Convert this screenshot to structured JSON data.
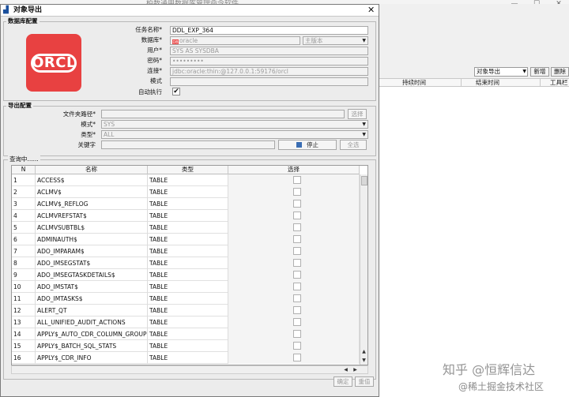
{
  "background": {
    "app_title": "柏数通用数据库管理命令软件",
    "toolbar": {
      "export_select": "对象导出",
      "new_button": "新增",
      "delete_button": "删除",
      "tools_button": "工具栏"
    },
    "columns": [
      "持续时间",
      "结束时间",
      "工具栏"
    ]
  },
  "dialog": {
    "title": "对象导出",
    "close": "✕",
    "db_config": {
      "group_label": "数据库配置",
      "logo_text": "ORCL",
      "task_name_label": "任务名称*",
      "task_name_value": "DDL_EXP_364",
      "database_label": "数据库*",
      "database_value": "oracle",
      "database_mode_value": "主版本",
      "user_label": "用户*",
      "user_value": "SYS AS SYSDBA",
      "password_label": "密码*",
      "password_value": "•••••••••",
      "connection_label": "连接*",
      "connection_value": "jdbc:oracle:thin:@127.0.0.1:59176/orcl",
      "schema_label": "模式",
      "schema_value": "",
      "auto_exec_label": "自动执行",
      "auto_exec_checked": "✔"
    },
    "export_config": {
      "group_label": "导出配置",
      "folder_label": "文件夹路径*",
      "folder_value": "",
      "browse_button": "选择",
      "schema_label": "模式*",
      "schema_value": "SYS",
      "type_label": "类型*",
      "type_value": "ALL",
      "keyword_label": "关键字",
      "keyword_value": "",
      "stop_button": "停止",
      "select_all_button": "全选"
    },
    "query": {
      "group_label": "查询中......",
      "columns": [
        "N",
        "名称",
        "类型",
        "选择"
      ],
      "rows": [
        {
          "n": "1",
          "name": "ACCESS$",
          "type": "TABLE"
        },
        {
          "n": "2",
          "name": "ACLMV$",
          "type": "TABLE"
        },
        {
          "n": "3",
          "name": "ACLMV$_REFLOG",
          "type": "TABLE"
        },
        {
          "n": "4",
          "name": "ACLMVREFSTAT$",
          "type": "TABLE"
        },
        {
          "n": "5",
          "name": "ACLMVSUBTBL$",
          "type": "TABLE"
        },
        {
          "n": "6",
          "name": "ADMINAUTH$",
          "type": "TABLE"
        },
        {
          "n": "7",
          "name": "ADO_IMPARAM$",
          "type": "TABLE"
        },
        {
          "n": "8",
          "name": "ADO_IMSEGSTAT$",
          "type": "TABLE"
        },
        {
          "n": "9",
          "name": "ADO_IMSEGTASKDETAILS$",
          "type": "TABLE"
        },
        {
          "n": "10",
          "name": "ADO_IMSTAT$",
          "type": "TABLE"
        },
        {
          "n": "11",
          "name": "ADO_IMTASKS$",
          "type": "TABLE"
        },
        {
          "n": "12",
          "name": "ALERT_QT",
          "type": "TABLE"
        },
        {
          "n": "13",
          "name": "ALL_UNIFIED_AUDIT_ACTIONS",
          "type": "TABLE"
        },
        {
          "n": "14",
          "name": "APPLY$_AUTO_CDR_COLUMN_GROUPS",
          "type": "TABLE"
        },
        {
          "n": "15",
          "name": "APPLY$_BATCH_SQL_STATS",
          "type": "TABLE"
        },
        {
          "n": "16",
          "name": "APPLY$_CDR_INFO",
          "type": "TABLE"
        }
      ]
    },
    "footer": {
      "confirm_button": "确定",
      "cancel_button": "重值"
    }
  },
  "watermark": {
    "line1": "知乎 @恒辉信达",
    "line2": "@稀土掘金技术社区"
  },
  "colors": {
    "logo_red": "#e84141",
    "stop_icon_blue": "#3a6db3"
  }
}
